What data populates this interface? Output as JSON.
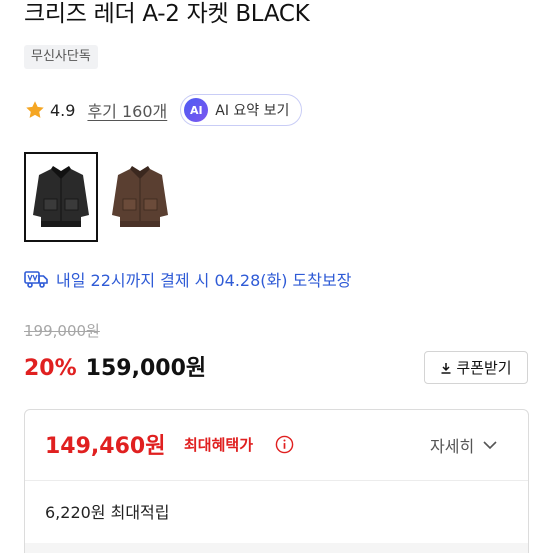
{
  "product": {
    "title": "크리즈 레더 A-2 자켓 BLACK",
    "brand": "무신사단독"
  },
  "rating": {
    "value": "4.9",
    "review_link": "후기 160개",
    "star_icon": "star-icon",
    "ai_badge": "AI",
    "ai_label": "AI 요약 보기"
  },
  "thumbnails": [
    {
      "name": "black jacket",
      "selected": true,
      "color": "#2a2a2a"
    },
    {
      "name": "brown jacket",
      "selected": false,
      "color": "#5a3f31"
    }
  ],
  "delivery": {
    "text": "내일 22시까지 결제 시 04.28(화) 도착보장",
    "icon": "delivery-truck-icon",
    "color": "#2f5bd6"
  },
  "price": {
    "original": "199,000원",
    "discount": "20%",
    "sale": "159,000원",
    "coupon_button": "쿠폰받기"
  },
  "benefit": {
    "max_price": "149,460원",
    "max_label": "최대혜택가",
    "detail_link": "자세히",
    "points": "6,220원 최대적립"
  },
  "colors": {
    "accent_red": "#e02020",
    "link_blue": "#2f5bd6",
    "ai_purple": "#5b5cf0"
  }
}
